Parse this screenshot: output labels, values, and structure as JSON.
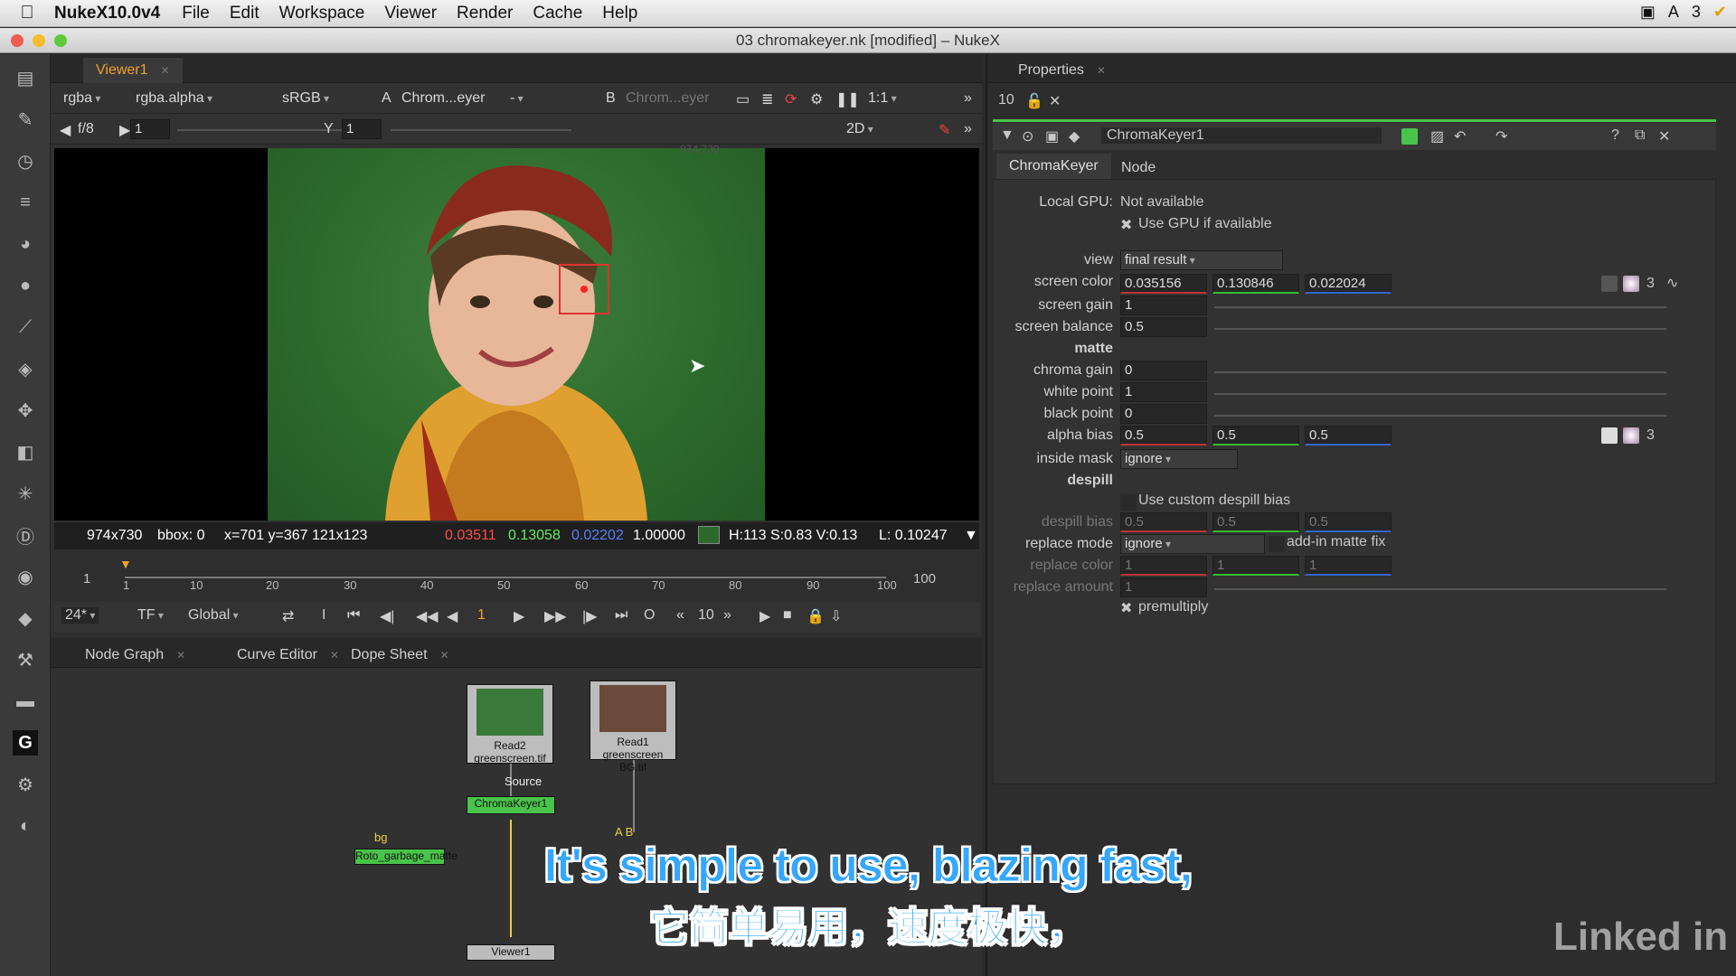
{
  "menubar": {
    "app": "NukeX10.0v4",
    "items": [
      "File",
      "Edit",
      "Workspace",
      "Viewer",
      "Render",
      "Cache",
      "Help"
    ],
    "status_right": "3"
  },
  "window": {
    "title": "03 chromakeyer.nk [modified] – NukeX"
  },
  "viewer": {
    "tab": "Viewer1",
    "channels": "rgba",
    "alpha": "rgba.alpha",
    "colorspace": "sRGB",
    "input_a": "Chrom...eyer",
    "a_dash": "-",
    "input_b": "Chrom...eyer",
    "zoom": "1:1",
    "fstop": "f/8",
    "frame_field": "1",
    "y_label": "Y",
    "y_field": "1",
    "mode": "2D",
    "coord_overlay": "974,730"
  },
  "status": {
    "size": "974x730",
    "bbox": "bbox: 0",
    "pos": "x=701 y=367 121x123",
    "r": "0.03511",
    "g": "0.13058",
    "b": "0.02202",
    "a": "1.00000",
    "hsv": "H:113 S:0.83 V:0.13",
    "lum": "L: 0.10247"
  },
  "timeline": {
    "start": "1",
    "end": "100",
    "ticks": [
      "1",
      "10",
      "20",
      "30",
      "40",
      "50",
      "60",
      "70",
      "80",
      "90",
      "100"
    ]
  },
  "playback": {
    "fps": "24*",
    "tf": "TF",
    "global": "Global",
    "frame": "1",
    "step": "10"
  },
  "bottom_tabs": [
    {
      "label": "Node Graph"
    },
    {
      "label": "Curve Editor"
    },
    {
      "label": "Dope Sheet"
    }
  ],
  "nodes": {
    "read2": "Read2",
    "read2_file": "greenscreen.tif",
    "read1": "Read1",
    "read1_file": "greenscreen BG.tif",
    "source": "Source",
    "chroma": "ChromaKeyer1",
    "bg": "bg",
    "roto": "Roto_garbage_matte",
    "ab": "A B",
    "viewer": "Viewer1"
  },
  "props": {
    "tab": "Properties",
    "count": "10",
    "node_name": "ChromaKeyer1",
    "tabs": [
      "ChromaKeyer",
      "Node"
    ],
    "local_gpu_label": "Local GPU:",
    "local_gpu_value": "Not available",
    "use_gpu": "Use GPU if available",
    "view_label": "view",
    "view_value": "final result",
    "screen_color_label": "screen color",
    "screen_color": [
      "0.035156",
      "0.130846",
      "0.022024"
    ],
    "screen_gain_label": "screen gain",
    "screen_gain": "1",
    "screen_balance_label": "screen balance",
    "screen_balance": "0.5",
    "matte_header": "matte",
    "chroma_gain_label": "chroma gain",
    "chroma_gain": "0",
    "white_point_label": "white point",
    "white_point": "1",
    "black_point_label": "black point",
    "black_point": "0",
    "alpha_bias_label": "alpha bias",
    "alpha_bias": [
      "0.5",
      "0.5",
      "0.5"
    ],
    "inside_mask_label": "inside mask",
    "inside_mask": "ignore",
    "despill_header": "despill",
    "custom_despill": "Use custom despill bias",
    "despill_bias_label": "despill bias",
    "despill_bias": [
      "0.5",
      "0.5",
      "0.5"
    ],
    "replace_mode_label": "replace mode",
    "replace_mode": "ignore",
    "addin": "add-in matte fix",
    "replace_color_label": "replace color",
    "replace_color": [
      "1",
      "1",
      "1"
    ],
    "replace_amount_label": "replace amount",
    "replace_amount": "1",
    "premultiply": "premultiply",
    "channel_count": "3"
  },
  "subtitles": {
    "en": "It's simple to use, blazing fast,",
    "zh": "它简单易用，速度极快，"
  },
  "watermark": "Linked in"
}
